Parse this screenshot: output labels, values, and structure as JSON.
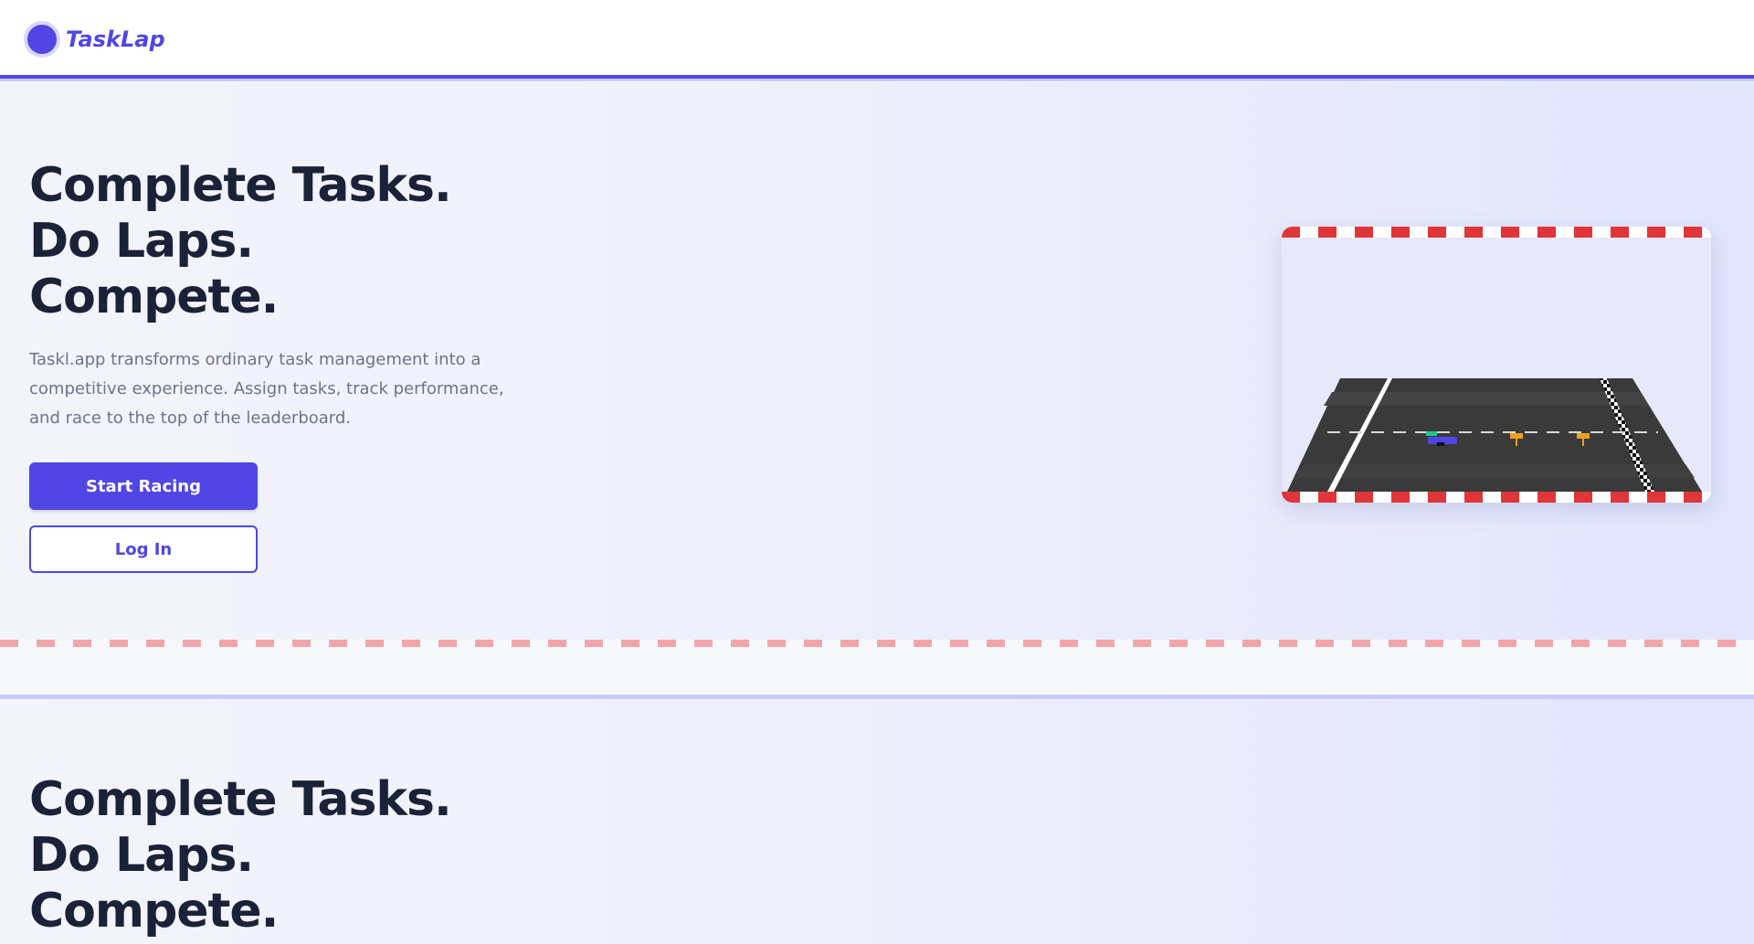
{
  "header": {
    "brand": "TaskLap"
  },
  "hero": {
    "headline": [
      "Complete Tasks.",
      "Do Laps.",
      "Compete."
    ],
    "description": "Taskl.app transforms ordinary task management into a competitive experience. Assign tasks, track performance, and race to the top of the leaderboard.",
    "primary_button": "Start Racing",
    "secondary_button": "Log In"
  },
  "hero_repeat": {
    "headline": [
      "Complete Tasks.",
      "Do Laps.",
      "Compete."
    ]
  },
  "colors": {
    "brand": "#4f46e5",
    "heading": "#1a2238",
    "curb_red": "#e0363a",
    "track_asphalt": "#3a3a3a"
  },
  "icons": {
    "logo": "brand-circle-icon",
    "race_track": "race-track-illustration"
  }
}
